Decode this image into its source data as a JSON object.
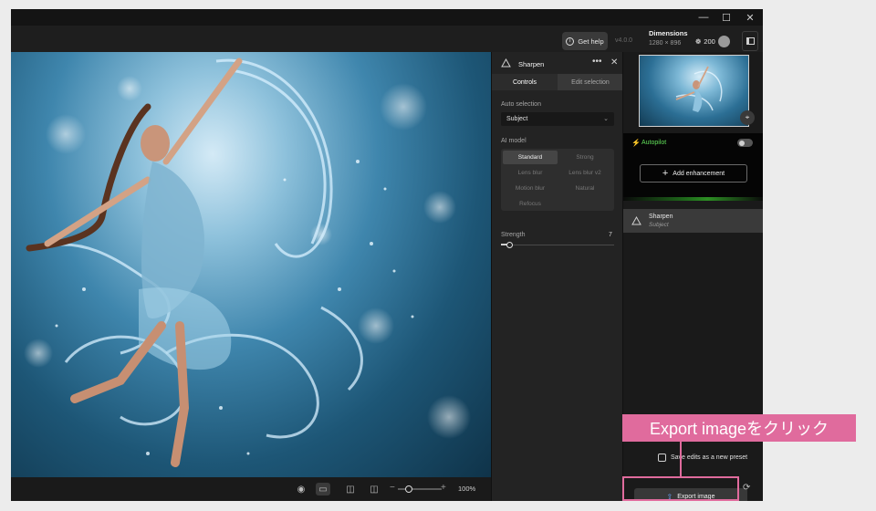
{
  "window": {
    "minimize_icon": "minimize-icon",
    "maximize_icon": "maximize-icon",
    "close_icon": "close-icon"
  },
  "toolbar": {
    "get_help_label": "Get help",
    "version": "v4.0.0",
    "dimensions_label": "Dimensions",
    "dimensions_value": "1280 × 896",
    "credits": "200"
  },
  "bottombar": {
    "zoom_minus": "−",
    "zoom_plus": "+",
    "zoom_value": "100%",
    "zoom_level": 0.25
  },
  "tool_panel": {
    "title": "Sharpen",
    "more": "•••",
    "close": "✕",
    "tabs": [
      {
        "label": "Controls",
        "active": true
      },
      {
        "label": "Edit selection",
        "active": false
      }
    ],
    "auto_selection_label": "Auto selection",
    "auto_selection_value": "Subject",
    "ai_model_label": "AI model",
    "models": [
      "Standard",
      "Strong",
      "Lens blur",
      "Lens blur v2",
      "Motion blur",
      "Natural",
      "Refocus"
    ],
    "selected_model": "Standard",
    "strength_label": "Strength",
    "strength_value": "7",
    "strength_fraction": 0.07
  },
  "right_panel": {
    "autopilot_label": "Autopilot",
    "autopilot_on": false,
    "add_enhancement_label": "Add enhancement",
    "enhancement_name": "Sharpen",
    "enhancement_sub": "Subject",
    "save_preset_label": "Save edits as a new preset",
    "export_label": "Export image"
  },
  "annotation": {
    "callout_text": "Export imageをクリック",
    "color": "#e06b9d"
  },
  "colors": {
    "accent_green": "#62e05a",
    "annotation_pink": "#e06b9d"
  }
}
